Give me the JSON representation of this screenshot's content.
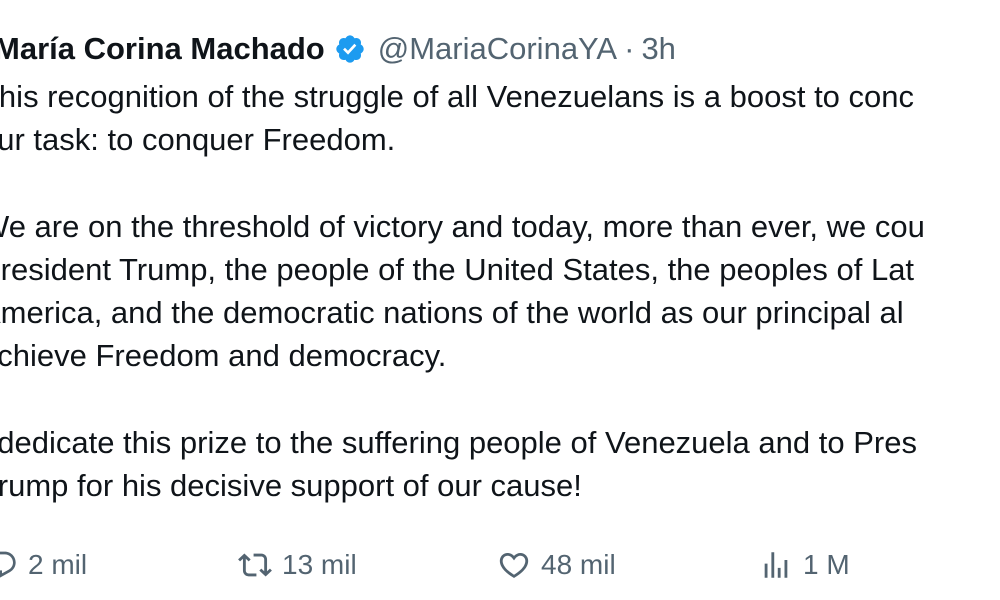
{
  "tweet": {
    "author": {
      "display_name": "María Corina Machado",
      "verified": true,
      "handle": "@MariaCorinaYA",
      "separator": "·",
      "time": "3h"
    },
    "paragraphs": [
      [
        "This recognition of the struggle of all Venezuelans is a boost to conc",
        "our task: to conquer Freedom."
      ],
      [
        "We are on the threshold of victory and today, more than ever, we cou",
        "President Trump, the people of the United States, the peoples of Lat",
        "America, and the democratic nations of the world as our principal al",
        "achieve Freedom and democracy."
      ],
      [
        "I dedicate this prize to the suffering people of Venezuela and to Pres",
        "Trump for his decisive support of our cause!"
      ]
    ],
    "actions": {
      "replies": "2 mil",
      "reposts": "13 mil",
      "likes": "48 mil",
      "views": "1 M"
    },
    "colors": {
      "text": "#0f1419",
      "secondary": "#536471",
      "verified_badge": "#1d9bf0"
    },
    "icons": {
      "verified": "verified-badge-icon",
      "reply": "reply-icon",
      "repost": "repost-icon",
      "like": "heart-icon",
      "views": "views-icon"
    }
  }
}
